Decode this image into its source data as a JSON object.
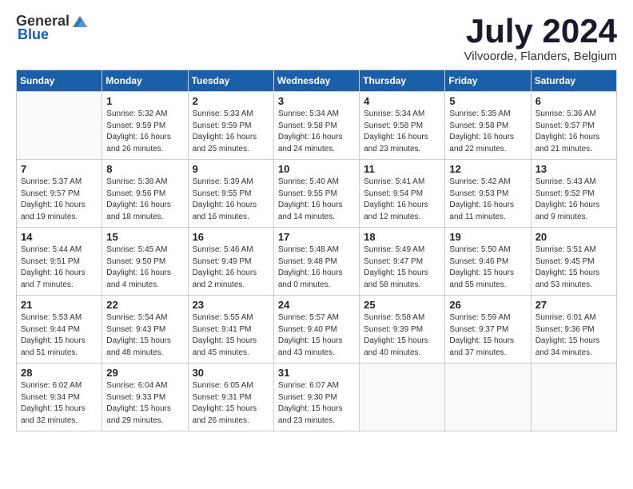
{
  "header": {
    "logo_general": "General",
    "logo_blue": "Blue",
    "month_title": "July 2024",
    "location": "Vilvoorde, Flanders, Belgium"
  },
  "days_of_week": [
    "Sunday",
    "Monday",
    "Tuesday",
    "Wednesday",
    "Thursday",
    "Friday",
    "Saturday"
  ],
  "weeks": [
    [
      {
        "day": "",
        "info": ""
      },
      {
        "day": "1",
        "info": "Sunrise: 5:32 AM\nSunset: 9:59 PM\nDaylight: 16 hours\nand 26 minutes."
      },
      {
        "day": "2",
        "info": "Sunrise: 5:33 AM\nSunset: 9:59 PM\nDaylight: 16 hours\nand 25 minutes."
      },
      {
        "day": "3",
        "info": "Sunrise: 5:34 AM\nSunset: 9:58 PM\nDaylight: 16 hours\nand 24 minutes."
      },
      {
        "day": "4",
        "info": "Sunrise: 5:34 AM\nSunset: 9:58 PM\nDaylight: 16 hours\nand 23 minutes."
      },
      {
        "day": "5",
        "info": "Sunrise: 5:35 AM\nSunset: 9:58 PM\nDaylight: 16 hours\nand 22 minutes."
      },
      {
        "day": "6",
        "info": "Sunrise: 5:36 AM\nSunset: 9:57 PM\nDaylight: 16 hours\nand 21 minutes."
      }
    ],
    [
      {
        "day": "7",
        "info": "Sunrise: 5:37 AM\nSunset: 9:57 PM\nDaylight: 16 hours\nand 19 minutes."
      },
      {
        "day": "8",
        "info": "Sunrise: 5:38 AM\nSunset: 9:56 PM\nDaylight: 16 hours\nand 18 minutes."
      },
      {
        "day": "9",
        "info": "Sunrise: 5:39 AM\nSunset: 9:55 PM\nDaylight: 16 hours\nand 16 minutes."
      },
      {
        "day": "10",
        "info": "Sunrise: 5:40 AM\nSunset: 9:55 PM\nDaylight: 16 hours\nand 14 minutes."
      },
      {
        "day": "11",
        "info": "Sunrise: 5:41 AM\nSunset: 9:54 PM\nDaylight: 16 hours\nand 12 minutes."
      },
      {
        "day": "12",
        "info": "Sunrise: 5:42 AM\nSunset: 9:53 PM\nDaylight: 16 hours\nand 11 minutes."
      },
      {
        "day": "13",
        "info": "Sunrise: 5:43 AM\nSunset: 9:52 PM\nDaylight: 16 hours\nand 9 minutes."
      }
    ],
    [
      {
        "day": "14",
        "info": "Sunrise: 5:44 AM\nSunset: 9:51 PM\nDaylight: 16 hours\nand 7 minutes."
      },
      {
        "day": "15",
        "info": "Sunrise: 5:45 AM\nSunset: 9:50 PM\nDaylight: 16 hours\nand 4 minutes."
      },
      {
        "day": "16",
        "info": "Sunrise: 5:46 AM\nSunset: 9:49 PM\nDaylight: 16 hours\nand 2 minutes."
      },
      {
        "day": "17",
        "info": "Sunrise: 5:48 AM\nSunset: 9:48 PM\nDaylight: 16 hours\nand 0 minutes."
      },
      {
        "day": "18",
        "info": "Sunrise: 5:49 AM\nSunset: 9:47 PM\nDaylight: 15 hours\nand 58 minutes."
      },
      {
        "day": "19",
        "info": "Sunrise: 5:50 AM\nSunset: 9:46 PM\nDaylight: 15 hours\nand 55 minutes."
      },
      {
        "day": "20",
        "info": "Sunrise: 5:51 AM\nSunset: 9:45 PM\nDaylight: 15 hours\nand 53 minutes."
      }
    ],
    [
      {
        "day": "21",
        "info": "Sunrise: 5:53 AM\nSunset: 9:44 PM\nDaylight: 15 hours\nand 51 minutes."
      },
      {
        "day": "22",
        "info": "Sunrise: 5:54 AM\nSunset: 9:43 PM\nDaylight: 15 hours\nand 48 minutes."
      },
      {
        "day": "23",
        "info": "Sunrise: 5:55 AM\nSunset: 9:41 PM\nDaylight: 15 hours\nand 45 minutes."
      },
      {
        "day": "24",
        "info": "Sunrise: 5:57 AM\nSunset: 9:40 PM\nDaylight: 15 hours\nand 43 minutes."
      },
      {
        "day": "25",
        "info": "Sunrise: 5:58 AM\nSunset: 9:39 PM\nDaylight: 15 hours\nand 40 minutes."
      },
      {
        "day": "26",
        "info": "Sunrise: 5:59 AM\nSunset: 9:37 PM\nDaylight: 15 hours\nand 37 minutes."
      },
      {
        "day": "27",
        "info": "Sunrise: 6:01 AM\nSunset: 9:36 PM\nDaylight: 15 hours\nand 34 minutes."
      }
    ],
    [
      {
        "day": "28",
        "info": "Sunrise: 6:02 AM\nSunset: 9:34 PM\nDaylight: 15 hours\nand 32 minutes."
      },
      {
        "day": "29",
        "info": "Sunrise: 6:04 AM\nSunset: 9:33 PM\nDaylight: 15 hours\nand 29 minutes."
      },
      {
        "day": "30",
        "info": "Sunrise: 6:05 AM\nSunset: 9:31 PM\nDaylight: 15 hours\nand 26 minutes."
      },
      {
        "day": "31",
        "info": "Sunrise: 6:07 AM\nSunset: 9:30 PM\nDaylight: 15 hours\nand 23 minutes."
      },
      {
        "day": "",
        "info": ""
      },
      {
        "day": "",
        "info": ""
      },
      {
        "day": "",
        "info": ""
      }
    ]
  ]
}
